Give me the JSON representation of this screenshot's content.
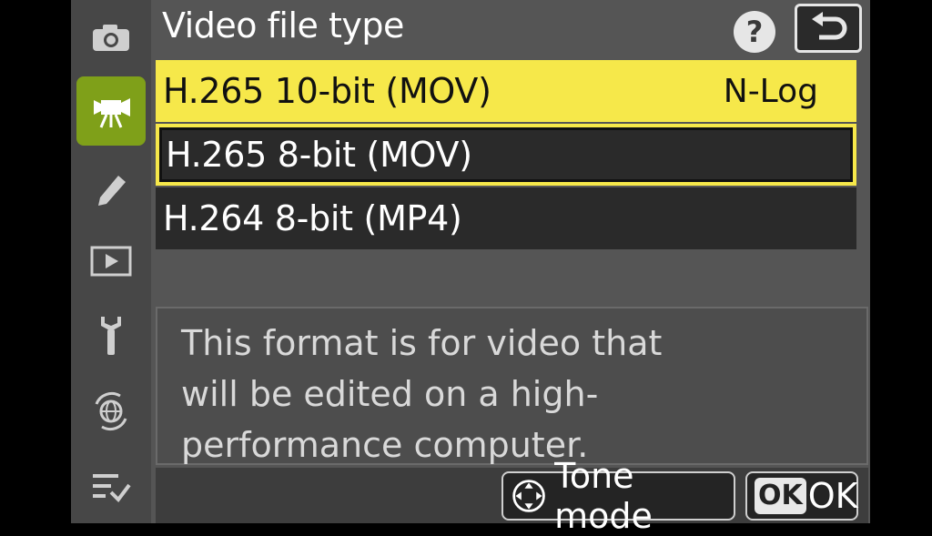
{
  "header": {
    "title": "Video file type",
    "help_icon": "?",
    "back_icon": "return-arrow-icon"
  },
  "sidebar": {
    "items": [
      {
        "name": "photo-shooting-menu",
        "icon": "camera-icon",
        "active": false
      },
      {
        "name": "video-recording-menu",
        "icon": "movie-camera-icon",
        "active": true
      },
      {
        "name": "custom-settings-menu",
        "icon": "pencil-icon",
        "active": false
      },
      {
        "name": "playback-menu",
        "icon": "play-icon",
        "active": false
      },
      {
        "name": "setup-menu",
        "icon": "wrench-icon",
        "active": false
      },
      {
        "name": "network-menu",
        "icon": "network-globe-icon",
        "active": false
      },
      {
        "name": "my-menu",
        "icon": "list-check-icon",
        "active": false
      }
    ]
  },
  "options": [
    {
      "label": "H.265 10-bit (MOV)",
      "tag": "N-Log",
      "state": "highlighted"
    },
    {
      "label": "H.265 8-bit (MOV)",
      "tag": "",
      "state": "cursor"
    },
    {
      "label": "H.264 8-bit (MP4)",
      "tag": "",
      "state": "normal"
    }
  ],
  "help_text": {
    "line1": "This format is for video that",
    "line2": "will be edited on a high-",
    "line3": "performance computer."
  },
  "footer": {
    "tone_mode_label": "Tone mode",
    "ok_badge": "OK",
    "ok_label": "OK"
  },
  "colors": {
    "active_tab": "#7fa019",
    "highlight": "#f6e84a"
  }
}
